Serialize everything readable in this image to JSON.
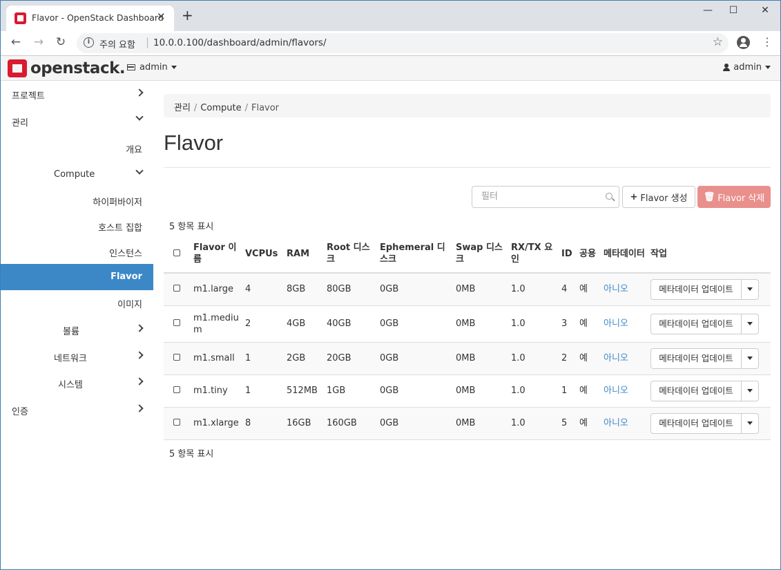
{
  "browser": {
    "tab_title": "Flavor - OpenStack Dashboard",
    "security_label": "주의 요함",
    "url": "10.0.0.100/dashboard/admin/flavors/"
  },
  "navbar": {
    "logo_text": "openstack.",
    "project": "admin",
    "user": "admin"
  },
  "sidebar": {
    "items": [
      {
        "label": "프로젝트",
        "chev": "right"
      },
      {
        "label": "관리",
        "chev": "down"
      },
      {
        "label": "개요"
      },
      {
        "label": "Compute",
        "chev": "down"
      },
      {
        "label": "하이퍼바이저"
      },
      {
        "label": "호스트 집합"
      },
      {
        "label": "인스턴스"
      },
      {
        "label": "Flavor",
        "active": true
      },
      {
        "label": "이미지"
      },
      {
        "label": "볼륨",
        "chev": "right"
      },
      {
        "label": "네트워크",
        "chev": "right"
      },
      {
        "label": "시스템",
        "chev": "right"
      },
      {
        "label": "인증",
        "chev": "right"
      }
    ]
  },
  "breadcrumb": {
    "items": [
      "관리",
      "Compute",
      "Flavor"
    ]
  },
  "page_title": "Flavor",
  "filter": {
    "placeholder": "필터"
  },
  "buttons": {
    "create": "Flavor 생성",
    "delete": "Flavor 삭제"
  },
  "count_label": "5 항목 표시",
  "table": {
    "headers": [
      "Flavor 이름",
      "VCPUs",
      "RAM",
      "Root 디스크",
      "Ephemeral 디스크",
      "Swap 디스크",
      "RX/TX 요인",
      "ID",
      "공용",
      "메타데이터",
      "작업"
    ],
    "rows": [
      [
        "m1.large",
        "4",
        "8GB",
        "80GB",
        "0GB",
        "0MB",
        "1.0",
        "4",
        "예",
        "아니오"
      ],
      [
        "m1.medium",
        "2",
        "4GB",
        "40GB",
        "0GB",
        "0MB",
        "1.0",
        "3",
        "예",
        "아니오"
      ],
      [
        "m1.small",
        "1",
        "2GB",
        "20GB",
        "0GB",
        "0MB",
        "1.0",
        "2",
        "예",
        "아니오"
      ],
      [
        "m1.tiny",
        "1",
        "512MB",
        "1GB",
        "0GB",
        "0MB",
        "1.0",
        "1",
        "예",
        "아니오"
      ],
      [
        "m1.xlarge",
        "8",
        "16GB",
        "160GB",
        "0GB",
        "0MB",
        "1.0",
        "5",
        "예",
        "아니오"
      ]
    ],
    "action_label": "메타데이터 업데이트"
  },
  "colors": {
    "accent": "#3c88c7",
    "danger_disabled": "#e9908c",
    "brand": "#da1a32"
  }
}
